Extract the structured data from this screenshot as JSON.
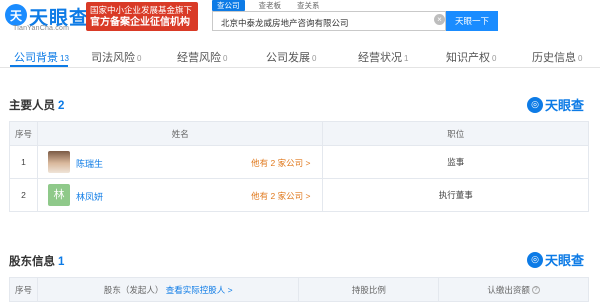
{
  "header": {
    "logo_icon": "天",
    "logo_text": "天眼查",
    "logo_url": "TianYanCha.com",
    "gov_badge_line1": "国家中小企业发展基金旗下",
    "gov_badge_line2": "官方备案企业征信机构",
    "search_tabs": [
      "查公司",
      "查老板",
      "查关系"
    ],
    "search_value": "北京中泰龙威房地产咨询有限公司",
    "search_clear": "×",
    "search_button": "天眼一下"
  },
  "nav": [
    {
      "label": "公司背景",
      "count": "13"
    },
    {
      "label": "司法风险",
      "count": "0"
    },
    {
      "label": "经营风险",
      "count": "0"
    },
    {
      "label": "公司发展",
      "count": "0"
    },
    {
      "label": "经营状况",
      "count": "1"
    },
    {
      "label": "知识产权",
      "count": "0"
    },
    {
      "label": "历史信息",
      "count": "0"
    }
  ],
  "personnel": {
    "title": "主要人员",
    "count": "2",
    "brand": "天眼查",
    "headers": [
      "序号",
      "姓名",
      "职位"
    ],
    "rows": [
      {
        "index": "1",
        "avatar": "",
        "name": "陈瑞生",
        "link": "他有 2 家公司 >",
        "position": "监事"
      },
      {
        "index": "2",
        "avatar": "林",
        "name": "林凤妍",
        "link": "他有 2 家公司 >",
        "position": "执行董事"
      }
    ]
  },
  "shareholders": {
    "title": "股东信息",
    "count": "1",
    "brand": "天眼查",
    "headers": {
      "index": "序号",
      "shareholder": "股东（发起人）",
      "controller_link": "查看实际控股人 >",
      "ratio": "持股比例",
      "subscribed": "认缴出资额"
    }
  }
}
